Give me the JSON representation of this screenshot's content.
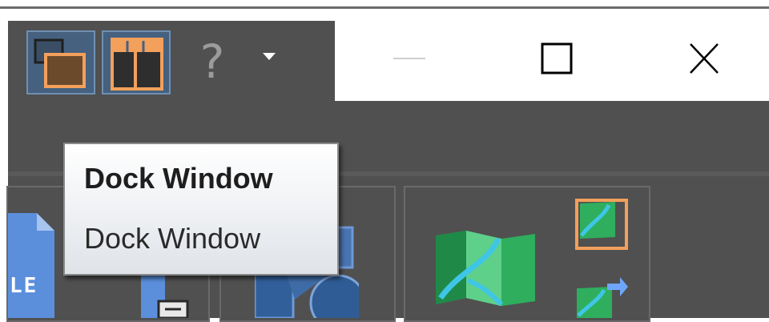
{
  "quick_access": {
    "float_window_icon": "float-window-icon",
    "layout_icon": "window-layout-icon",
    "help_label": "?",
    "menu_arrow_icon": "caret-down-icon"
  },
  "window_controls": {
    "minimize_icon": "minimize-icon",
    "maximize_icon": "maximize-icon",
    "close_icon": "close-icon"
  },
  "tooltip": {
    "title": "Dock Window",
    "description": "Dock Window"
  },
  "ribbon": {
    "partial_label": "LE"
  },
  "colors": {
    "dark_bg": "#505050",
    "active_btn": "#46617f",
    "icon_orange": "#f2a05c",
    "map_green": "#2fae5e",
    "map_blue": "#3fc6e6",
    "file_blue": "#5b8fdc"
  }
}
